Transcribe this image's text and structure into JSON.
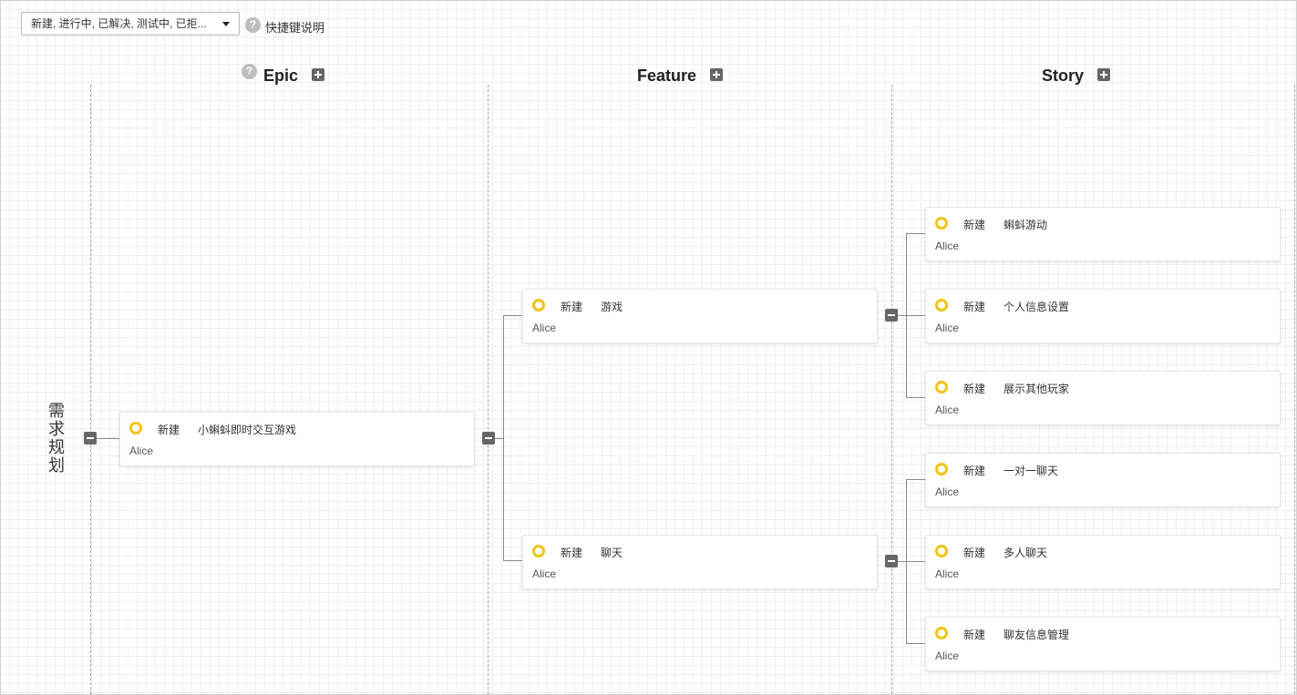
{
  "toolbar": {
    "status_filter_value": "新建, 进行中, 已解决, 测试中, 已拒...",
    "shortcut_help_icon": "?",
    "shortcut_help_label": "快捷键说明"
  },
  "columns": {
    "epic": {
      "help_icon": "?",
      "title": "Epic"
    },
    "feature": {
      "title": "Feature"
    },
    "story": {
      "title": "Story"
    }
  },
  "root": {
    "label": "需求规划"
  },
  "epics": [
    {
      "status": "新建",
      "title": "小蝌蚪即时交互游戏",
      "owner": "Alice"
    }
  ],
  "features": [
    {
      "status": "新建",
      "title": "游戏",
      "owner": "Alice"
    },
    {
      "status": "新建",
      "title": "聊天",
      "owner": "Alice"
    }
  ],
  "stories": [
    {
      "status": "新建",
      "title": "蝌蚪游动",
      "owner": "Alice"
    },
    {
      "status": "新建",
      "title": "个人信息设置",
      "owner": "Alice"
    },
    {
      "status": "新建",
      "title": "展示其他玩家",
      "owner": "Alice"
    },
    {
      "status": "新建",
      "title": "一对一聊天",
      "owner": "Alice"
    },
    {
      "status": "新建",
      "title": "多人聊天",
      "owner": "Alice"
    },
    {
      "status": "新建",
      "title": "聊友信息管理",
      "owner": "Alice"
    }
  ],
  "colors": {
    "status_new_ring": "#f2c413",
    "button_dark": "#666666",
    "grid_line": "#efefef"
  }
}
